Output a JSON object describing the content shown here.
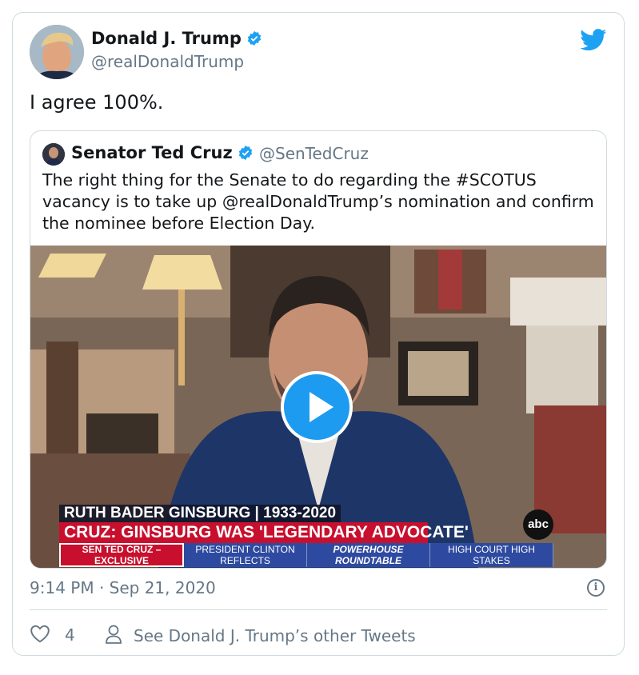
{
  "tweet": {
    "author_name": "Donald J. Trump",
    "author_handle": "@realDonaldTrump",
    "text": "I agree 100%.",
    "timestamp": "9:14 PM · Sep 21, 2020",
    "like_count": "4",
    "other_tweets_label": "See Donald J. Trump’s other Tweets"
  },
  "quoted": {
    "author_name": "Senator Ted Cruz",
    "author_handle": "@SenTedCruz",
    "text": "The right thing for the Senate to do regarding the #SCOTUS vacancy is to take up @realDonaldTrump’s nomination and confirm the nominee before Election Day."
  },
  "video": {
    "lower_third_top": "RUTH BADER GINSBURG | 1933-2020",
    "lower_third_main": "CRUZ: GINSBURG WAS 'LEGENDARY ADVOCATE'",
    "network_logo": "abc",
    "ticker": [
      {
        "label": "SEN TED CRUZ – EXCLUSIVE",
        "style": "red"
      },
      {
        "label": "PRESIDENT CLINTON REFLECTS",
        "style": "blue"
      },
      {
        "label": "POWERHOUSE ROUNDTABLE",
        "style": "blue"
      },
      {
        "label": "HIGH COURT HIGH STAKES",
        "style": "blue"
      }
    ]
  },
  "icons": {
    "verified": "verified-badge-icon",
    "brand": "twitter-bird-icon",
    "play": "play-icon",
    "info": "info-icon",
    "like": "heart-icon",
    "profile": "person-icon"
  },
  "colors": {
    "brand_blue": "#1da1f2",
    "text_secondary": "#657786",
    "border": "#cfd9de",
    "news_red": "#c8102e",
    "news_blue": "#2e4aa0"
  }
}
